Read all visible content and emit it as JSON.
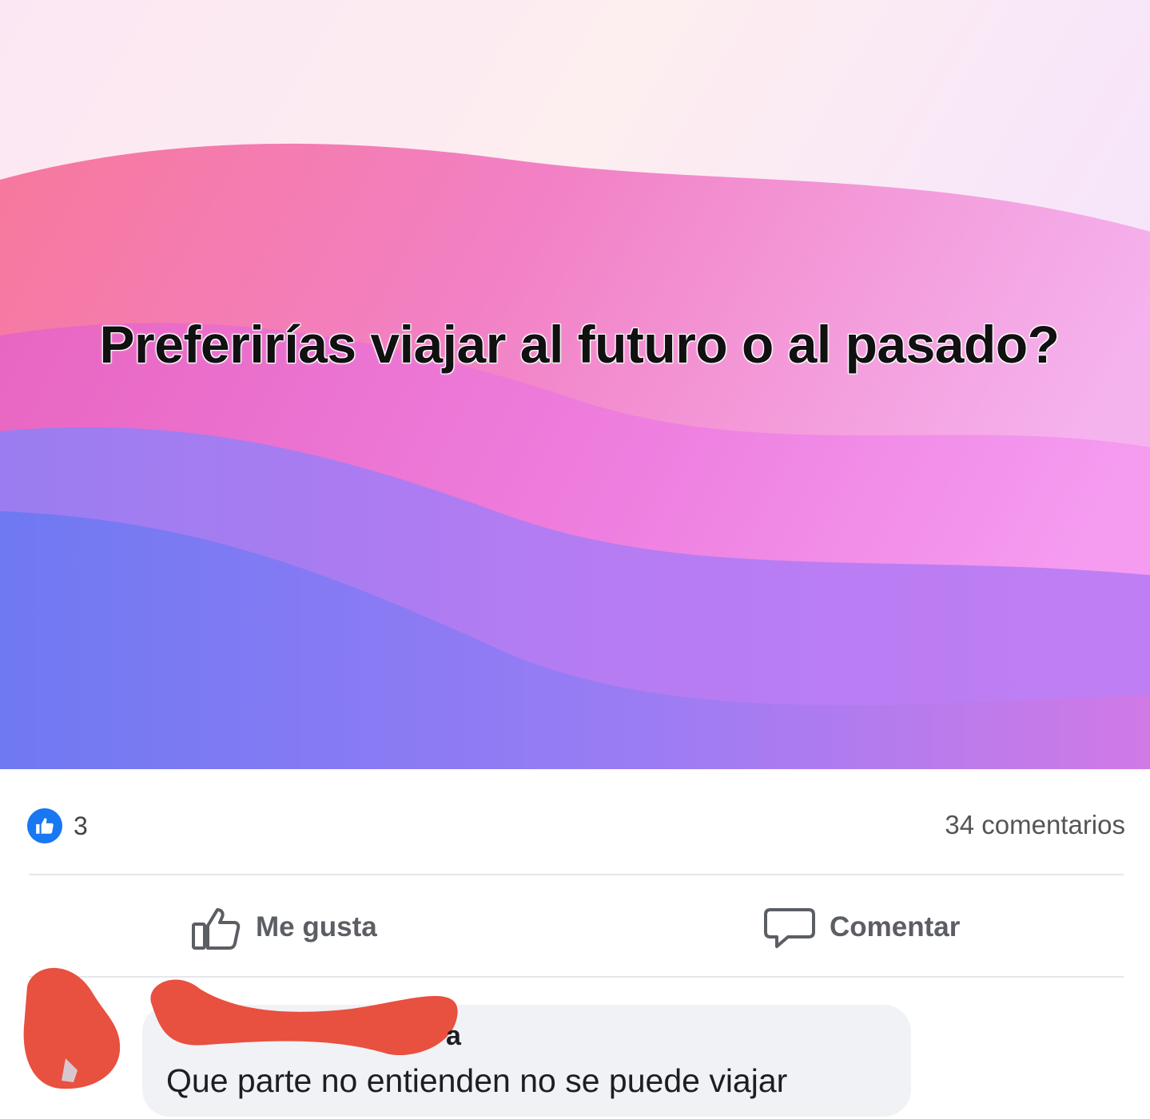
{
  "post": {
    "text": "Preferirías viajar al futuro o al pasado?"
  },
  "stats": {
    "likes": "3",
    "comments": "34 comentarios"
  },
  "actions": {
    "like_label": "Me gusta",
    "comment_label": "Comentar"
  },
  "comment": {
    "text": "Que parte no entienden no se puede viajar",
    "author_partial": "a"
  },
  "colors": {
    "like_blue": "#1877f2",
    "redaction_red": "#e8503f",
    "bubble_gray": "#f0f2f5"
  },
  "icons": {
    "like_badge": "thumbs-up-icon",
    "like_action": "thumbs-up-outline-icon",
    "comment_action": "speech-bubble-icon"
  }
}
